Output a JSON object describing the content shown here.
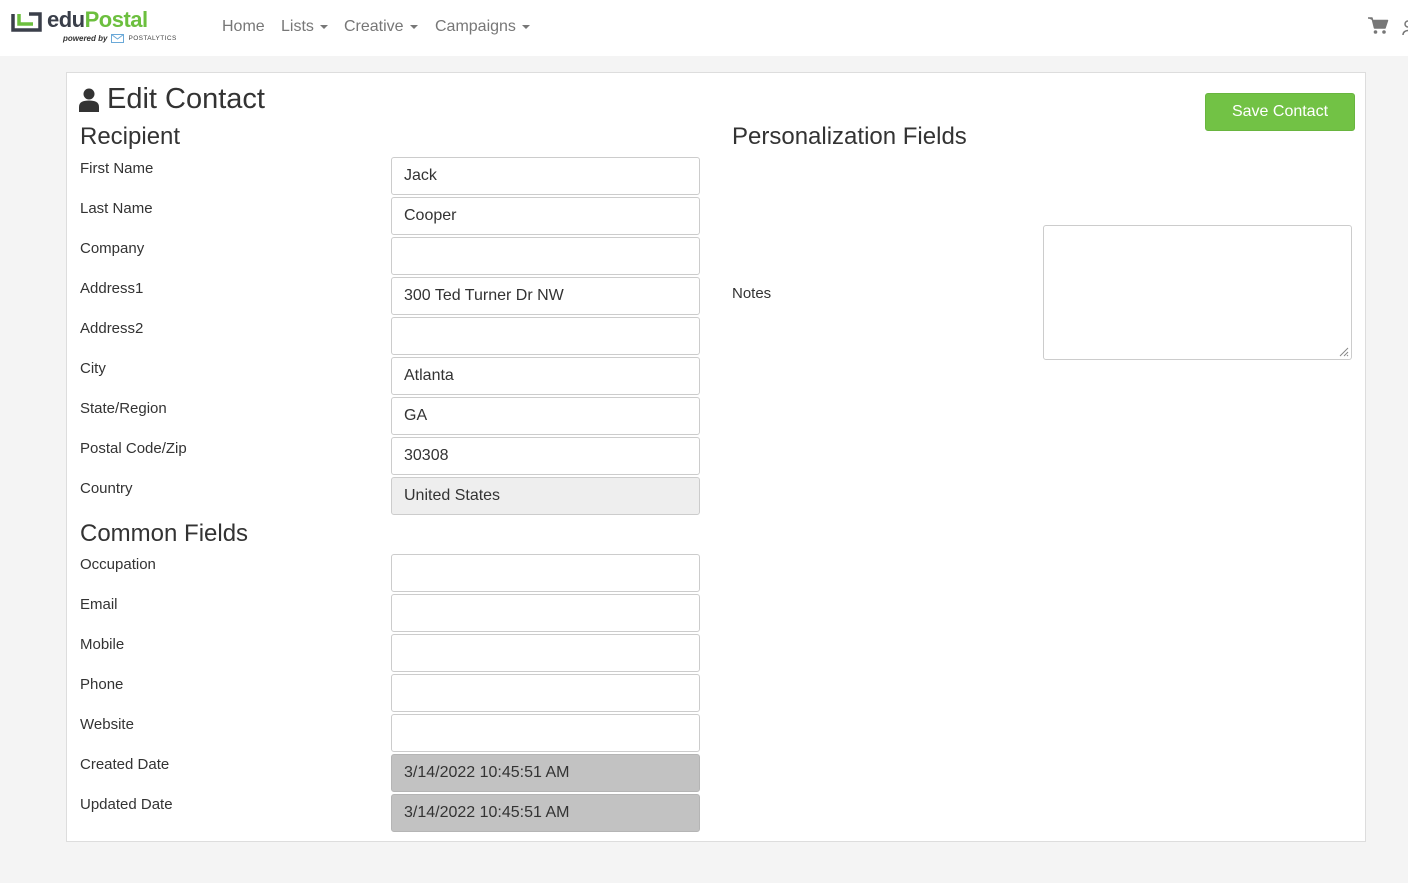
{
  "brand": {
    "name_part1": "edu",
    "name_part2": "Postal",
    "powered_by": "powered by",
    "partner": "POSTALYTICS",
    "accent_color": "#6cbf3e"
  },
  "nav": {
    "items": [
      {
        "label": "Home",
        "dropdown": false
      },
      {
        "label": "Lists",
        "dropdown": true
      },
      {
        "label": "Creative",
        "dropdown": true
      },
      {
        "label": "Campaigns",
        "dropdown": true
      }
    ],
    "cart_icon": "shopping-cart-icon"
  },
  "page": {
    "title": "Edit Contact",
    "title_icon": "user-icon",
    "save_label": "Save Contact",
    "save_color": "#72c245"
  },
  "recipient": {
    "heading": "Recipient",
    "fields": [
      {
        "label": "First Name",
        "value": "Jack"
      },
      {
        "label": "Last Name",
        "value": "Cooper"
      },
      {
        "label": "Company",
        "value": ""
      },
      {
        "label": "Address1",
        "value": "300 Ted Turner Dr NW"
      },
      {
        "label": "Address2",
        "value": ""
      },
      {
        "label": "City",
        "value": "Atlanta"
      },
      {
        "label": "State/Region",
        "value": "GA"
      },
      {
        "label": "Postal Code/Zip",
        "value": "30308"
      },
      {
        "label": "Country",
        "value": "United States"
      }
    ]
  },
  "common": {
    "heading": "Common Fields",
    "fields": [
      {
        "label": "Occupation",
        "value": ""
      },
      {
        "label": "Email",
        "value": ""
      },
      {
        "label": "Mobile",
        "value": ""
      },
      {
        "label": "Phone",
        "value": ""
      },
      {
        "label": "Website",
        "value": ""
      },
      {
        "label": "Created Date",
        "value": "3/14/2022 10:45:51 AM"
      },
      {
        "label": "Updated Date",
        "value": "3/14/2022 10:45:51 AM"
      }
    ]
  },
  "personalization": {
    "heading": "Personalization Fields",
    "notes_label": "Notes",
    "notes_value": ""
  }
}
